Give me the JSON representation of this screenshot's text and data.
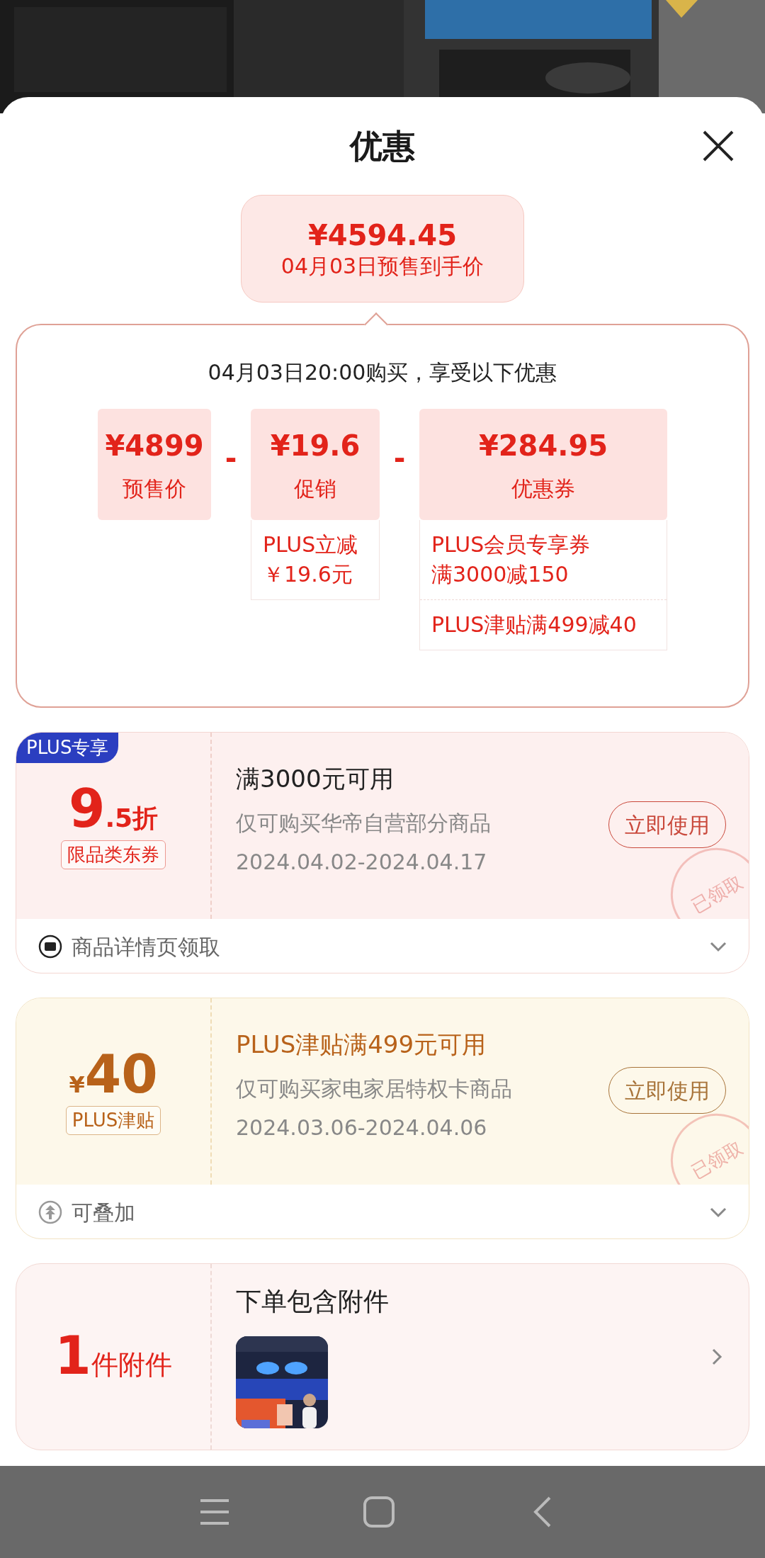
{
  "sheet": {
    "title": "优惠"
  },
  "price_bubble": {
    "price": "¥4594.45",
    "caption": "04月03日预售到手价"
  },
  "breakdown": {
    "intro": "04月03日20:00购买，享受以下优惠",
    "items": [
      {
        "amount": "¥4899",
        "label": "预售价"
      },
      {
        "operator": "-",
        "amount": "¥19.6",
        "label": "促销",
        "notes": [
          {
            "lines": [
              "PLUS立减",
              "￥19.6元"
            ]
          }
        ]
      },
      {
        "operator": "-",
        "amount": "¥284.95",
        "label": "优惠券",
        "notes": [
          {
            "lines": [
              "PLUS会员专享券",
              "满3000减150"
            ]
          },
          {
            "lines": [
              "PLUS津贴满499减40"
            ]
          }
        ]
      }
    ]
  },
  "coupons": [
    {
      "kind": "discount",
      "badge": "PLUS专享",
      "value_main": "9",
      "value_suffix": ".5折",
      "tag": "限品类东券",
      "title": "满3000元可用",
      "scope": "仅可购买华帝自营部分商品",
      "dates": "2024.04.02-2024.04.17",
      "button": "立即使用",
      "stamp": "已领取",
      "footer": "商品详情页领取",
      "expanded": false
    },
    {
      "kind": "subsidy",
      "currency": "¥",
      "value_main": "40",
      "tag": "PLUS津贴",
      "title": "PLUS津贴满499元可用",
      "scope": "仅可购买家电家居特权卡商品",
      "dates": "2024.03.06-2024.04.06",
      "button": "立即使用",
      "stamp": "已领取",
      "footer": "可叠加",
      "expanded": false
    }
  ],
  "accessory": {
    "count": "1",
    "unit": "件附件",
    "title": "下单包含附件"
  }
}
